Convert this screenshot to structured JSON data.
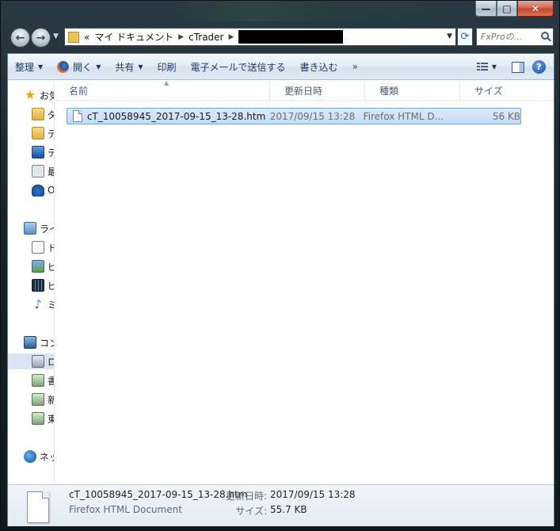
{
  "window": {
    "caption_buttons": {
      "minimize": "—",
      "maximize": "□",
      "close": "✕"
    }
  },
  "address_bar": {
    "overflow": "«",
    "crumbs": [
      "マイ ドキュメント",
      "cTrader"
    ],
    "redacted": true
  },
  "search": {
    "placeholder": "FxProの..."
  },
  "toolbar": {
    "organize": "整理",
    "open": "開く",
    "share": "共有",
    "print": "印刷",
    "email": "電子メールで送信する",
    "burn": "書き込む",
    "more": "»",
    "help": "?"
  },
  "nav_pane": {
    "items": [
      {
        "label": "お気",
        "icon": "star-icon"
      },
      {
        "label": "ダ",
        "icon": "downloads-folder-icon"
      },
      {
        "label": "デ",
        "icon": "folder-icon"
      },
      {
        "label": "デ",
        "icon": "desktop-icon"
      },
      {
        "label": "最",
        "icon": "recent-places-icon"
      },
      {
        "label": "O",
        "icon": "onedrive-cloud-icon"
      },
      {
        "label": "ライ",
        "icon": "libraries-icon"
      },
      {
        "label": "ド",
        "icon": "documents-icon"
      },
      {
        "label": "ピ",
        "icon": "pictures-icon"
      },
      {
        "label": "ビ",
        "icon": "videos-icon"
      },
      {
        "label": "ミ",
        "icon": "music-icon"
      },
      {
        "label": "コン",
        "icon": "computer-icon"
      },
      {
        "label": "ロ",
        "icon": "local-disk-icon"
      },
      {
        "label": "書",
        "icon": "network-drive-icon"
      },
      {
        "label": "新",
        "icon": "network-drive-icon"
      },
      {
        "label": "東",
        "icon": "network-drive-icon"
      },
      {
        "label": "ネッ",
        "icon": "network-icon"
      }
    ]
  },
  "columns": {
    "name": "名前",
    "date": "更新日時",
    "type": "種類",
    "size": "サイズ"
  },
  "files": [
    {
      "name": "cT_10058945_2017-09-15_13-28.htm",
      "date": "2017/09/15 13:28",
      "type": "Firefox HTML D...",
      "size": "56 KB"
    }
  ],
  "details": {
    "name": "cT_10058945_2017-09-15_13-28.htm",
    "type": "Firefox HTML Document",
    "modified_label": "更新日時:",
    "modified_value": "2017/09/15 13:28",
    "size_label": "サイズ:",
    "size_value": "55.7 KB"
  },
  "colors": {
    "selection": "#c1dcfc",
    "selection_border": "#7da2ce",
    "toolbar_text": "#1e395b",
    "header_text": "#4c607a"
  }
}
